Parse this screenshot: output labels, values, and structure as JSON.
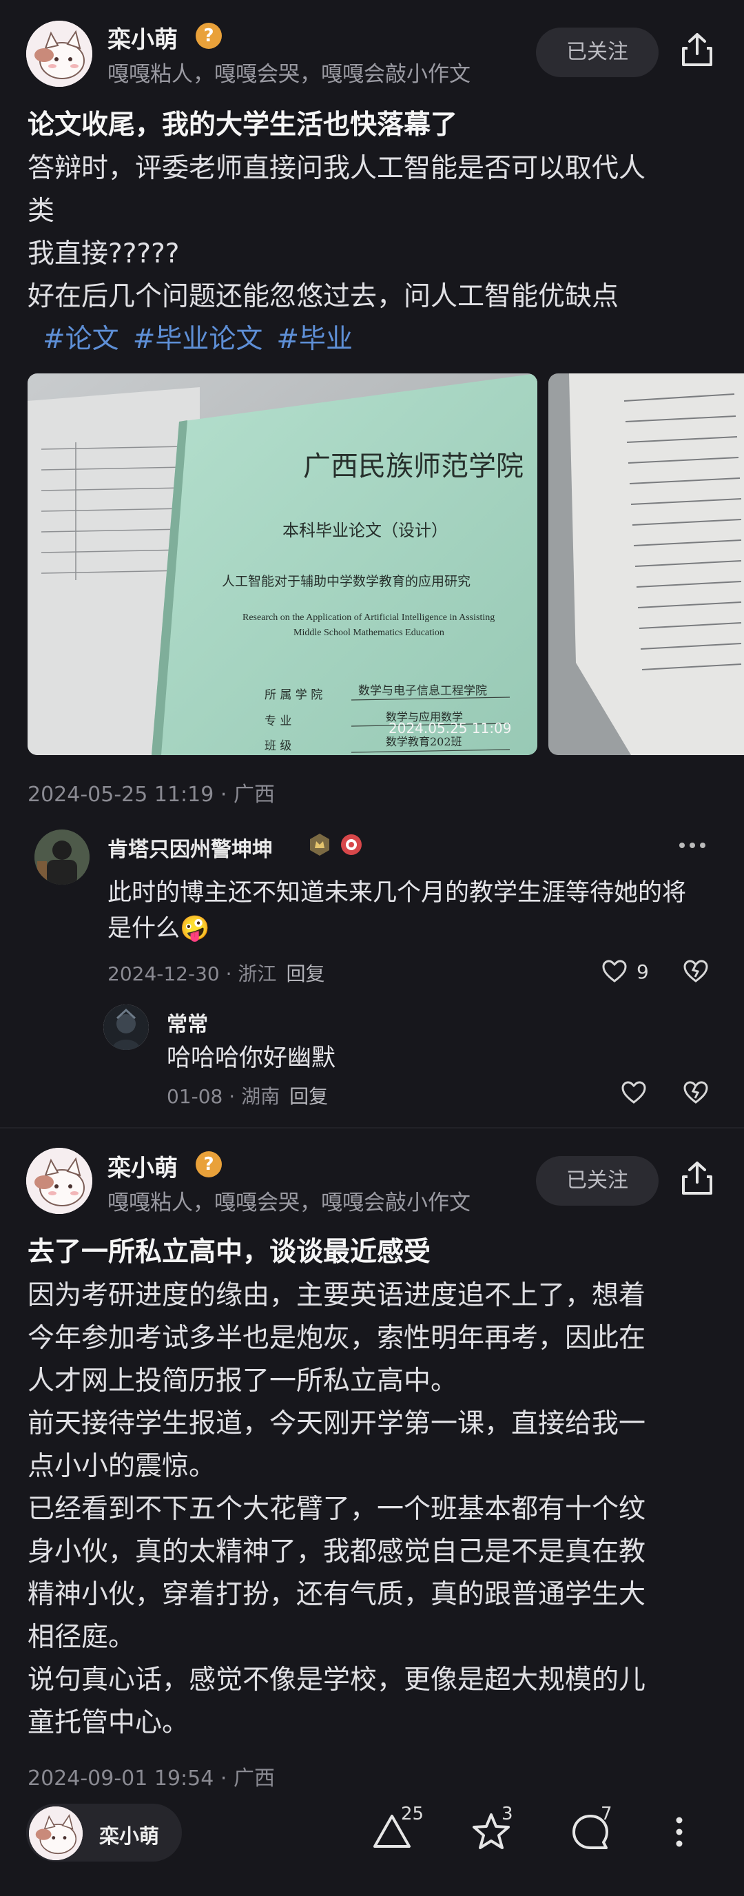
{
  "post1": {
    "author": "栾小萌",
    "badge": "?",
    "bio": "嘎嘎粘人，嘎嘎会哭，嘎嘎会敲小作文",
    "follow_label": "已关注",
    "title": "论文收尾，我的大学生活也快落幕了",
    "lines": [
      "答辩时，评委老师直接问我人工智能是否可以取代人",
      "类",
      "我直接?????",
      "好在后几个问题还能忽悠过去，问人工智能优缺点"
    ],
    "tags": [
      "#论文",
      "#毕业论文",
      "#毕业"
    ],
    "photo": {
      "college": "广西民族师范学院",
      "kind": "本科毕业论文（设计）",
      "cn_title": "人工智能对于辅助中学数学教育的应用研究",
      "en_line1": "Research on the Application of Artificial Intelligence in Assisting",
      "en_line2": "Middle School Mathematics Education",
      "field1_label": "所 属 学 院",
      "field1_value": "数学与电子信息工程学院",
      "field2_label": "专       业",
      "field2_value": "数学与应用数学",
      "field3_label": "班       级",
      "field3_value": "数学教育202班",
      "stamp": "2024.05.25  11:09"
    },
    "meta": "2024-05-25 11:19 · 广西"
  },
  "comments": [
    {
      "name": "肯塔只因州警坤坤",
      "text": "此时的博主还不知道未来几个月的教学生涯等待她的将是什么🤪",
      "meta": "2024-12-30 · 浙江",
      "reply": "回复",
      "likes": "9"
    },
    {
      "name": "常常",
      "text": "哈哈哈你好幽默",
      "meta": "01-08 · 湖南",
      "reply": "回复",
      "likes": ""
    }
  ],
  "post2": {
    "author": "栾小萌",
    "badge": "?",
    "bio": "嘎嘎粘人，嘎嘎会哭，嘎嘎会敲小作文",
    "follow_label": "已关注",
    "title": "去了一所私立高中，谈谈最近感受",
    "lines": [
      "因为考研进度的缘由，主要英语进度追不上了，想着",
      "今年参加考试多半也是炮灰，索性明年再考，因此在",
      "人才网上投简历报了一所私立高中。",
      "前天接待学生报道，今天刚开学第一课，直接给我一",
      "点小小的震惊。",
      "已经看到不下五个大花臂了，一个班基本都有十个纹",
      "身小伙，真的太精神了，我都感觉自己是不是真在教",
      "精神小伙，穿着打扮，还有气质，真的跟普通学生大",
      "相径庭。",
      "说句真心话，感觉不像是学校，更像是超大规模的儿",
      "童托管中心。"
    ],
    "meta": "2024-09-01 19:54 · 广西"
  },
  "bottom": {
    "user": "栾小萌",
    "like_count": "25",
    "star_count": "3",
    "comment_count": "7"
  },
  "colors": {
    "bg": "#17171c",
    "tag": "#5e8fd6",
    "badge": "#e9a13a",
    "cover": "#a9d7c4"
  }
}
